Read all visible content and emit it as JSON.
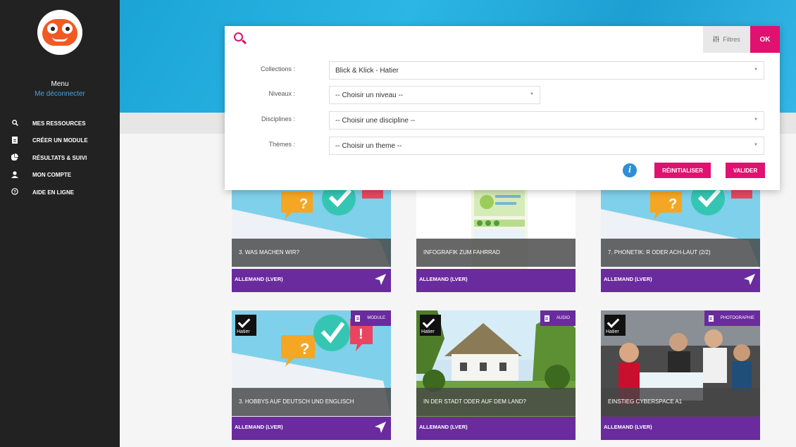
{
  "sidebar": {
    "menu_label": "Menu",
    "logout_label": "Me déconnecter",
    "items": [
      {
        "label": "MES RESSOURCES",
        "icon": "search-icon"
      },
      {
        "label": "CRÉER UN MODULE",
        "icon": "document-icon"
      },
      {
        "label": "RÉSULTATS & SUIVI",
        "icon": "chart-icon"
      },
      {
        "label": "MON COMPTE",
        "icon": "user-icon"
      },
      {
        "label": "AIDE EN LIGNE",
        "icon": "help-icon"
      }
    ]
  },
  "search": {
    "query": "",
    "filters_label": "Filtres",
    "ok_label": "OK",
    "collections_label": "Collections :",
    "collections_value": "Blick & Klick - Hatier",
    "niveaux_label": "Niveaux :",
    "niveaux_value": "-- Choisir un niveau --",
    "disciplines_label": "Disciplines :",
    "disciplines_value": "-- Choisir une discipline --",
    "themes_label": "Thèmes :",
    "themes_value": "-- Choisir un theme --",
    "reset_label": "RÉINITIALISER",
    "validate_label": "VALIDER"
  },
  "cards": [
    {
      "title": "3. WAS MACHEN WIR?",
      "subject": "ALLEMAND (LVER)",
      "type": ""
    },
    {
      "title": "INFOGRAFIK ZUM FAHRRAD",
      "subject": "ALLEMAND (LVER)",
      "type": ""
    },
    {
      "title": "7. PHONETIK: R ODER ACH-LAUT (2/2)",
      "subject": "ALLEMAND (LVER)",
      "type": ""
    },
    {
      "title": "3. HOBBYS AUF DEUTSCH UND ENGLISCH",
      "subject": "ALLEMAND (LVER)",
      "type": "MODULE",
      "publisher": "Hatier"
    },
    {
      "title": "IN DER STADT ODER AUF DEM LAND?",
      "subject": "ALLEMAND (LVER)",
      "type": "AUDIO",
      "publisher": "Hatier"
    },
    {
      "title": "EINSTIEG CYBERSPACE A1",
      "subject": "ALLEMAND (LVER)",
      "type": "PHOTOGRAPHIE",
      "publisher": "Hatier"
    }
  ],
  "colors": {
    "accent": "#e0116f",
    "purple": "#6a2b9e",
    "banner": "#1ba3d6",
    "sidebar": "#222222"
  }
}
